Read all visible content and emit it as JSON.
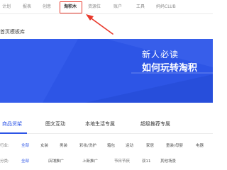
{
  "topnav": {
    "items": [
      "计划",
      "报表",
      "创意",
      "淘积木",
      "资源位",
      "账户",
      "工具",
      "妈妈CLUB"
    ],
    "active_index": 3
  },
  "page": {
    "heading": "首页模板库"
  },
  "banner": {
    "line1": "新人必读",
    "line2": "如何玩转淘积"
  },
  "tabs": {
    "items": [
      "商品货架",
      "图文互动",
      "本地生活专属",
      "超级推荐专属"
    ],
    "active_index": 0
  },
  "filters": {
    "row1": {
      "label": "行业:",
      "options": [
        "全部",
        "女装",
        "男装",
        "彩妆/洗护",
        "箱包",
        "运动",
        "家居",
        "童装/母婴",
        "电器"
      ],
      "selected_index": 0
    },
    "row2": {
      "label": "分类:",
      "options": [
        "全部",
        "店铺推广",
        "上新推广",
        "节日节庆",
        "双11",
        "其他场景"
      ],
      "selected_index": 0
    }
  },
  "colors": {
    "accent": "#2d55e6",
    "highlight": "#e8382b",
    "banner_bg": "#2d55e6"
  }
}
